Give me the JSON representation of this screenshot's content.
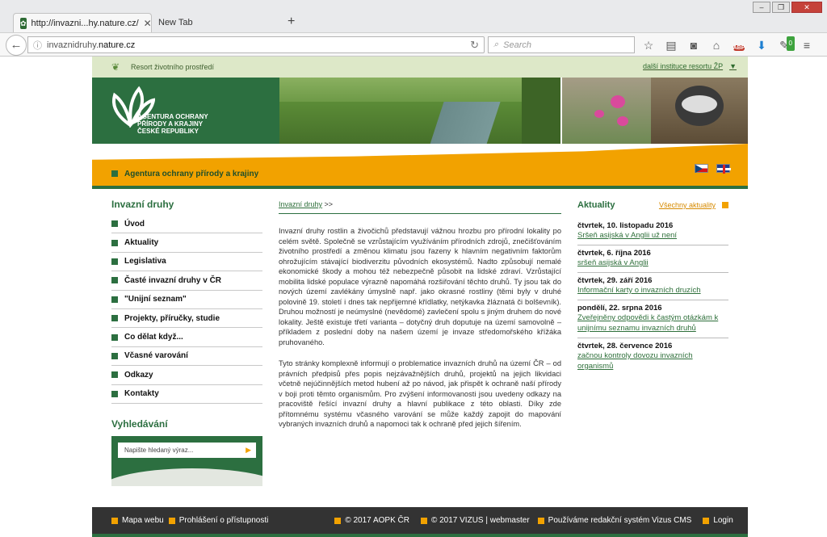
{
  "browser": {
    "tabs": [
      {
        "title": "http://invazni...hy.nature.cz/"
      },
      {
        "title": "New Tab"
      }
    ],
    "new_tab_symbol": "+",
    "url_host": "invaznidruhy.",
    "url_domain": "nature.cz",
    "search_placeholder": "Search",
    "addon_badge": "0",
    "abp_label": "ABP"
  },
  "ministry": {
    "label": "Resort životního prostředí",
    "other_link": "další instituce resortu ŽP"
  },
  "logo": {
    "lines": [
      "AGENTURA OCHRANY",
      "PŘÍRODY A KRAJINY",
      "ČESKÉ REPUBLIKY"
    ]
  },
  "org_bar": {
    "title": "Agentura ochrany přírody a krajiny"
  },
  "sidebar": {
    "heading": "Invazní druhy",
    "items": [
      {
        "label": "Úvod"
      },
      {
        "label": "Aktuality"
      },
      {
        "label": "Legislativa"
      },
      {
        "label": "Časté invazní druhy v ČR"
      },
      {
        "label": "\"Unijní seznam\""
      },
      {
        "label": "Projekty, příručky, studie"
      },
      {
        "label": "Co dělat když..."
      },
      {
        "label": "Včasné varování"
      },
      {
        "label": "Odkazy"
      },
      {
        "label": "Kontakty"
      }
    ],
    "search_heading": "Vyhledávání",
    "search_placeholder": "Napište hledaný výraz..."
  },
  "content": {
    "breadcrumb_link": "Invazní druhy",
    "breadcrumb_sep": ">>",
    "paragraphs": [
      "Invazní druhy rostlin a živočichů představují vážnou hrozbu pro přírodní lokality po celém světě. Společně se vzrůstajícím využíváním přírodních zdrojů, znečišťováním životního prostředí a změnou klimatu jsou řazeny k hlavním negativním faktorům ohrožujícím stávající biodiverzitu původních ekosystémů. Nadto způsobují nemalé ekonomické škody a mohou též nebezpečně působit na lidské zdraví. Vzrůstající mobilita lidské populace výrazně napomáhá rozšiřování těchto druhů. Ty jsou tak do nových území zavlékány úmyslně např. jako okrasné rostliny (těmi byly v druhé polovině 19. století i dnes tak nepřijemné křídlatky, netýkavka žláznatá či bolševník). Druhou možností je neúmyslné (nevědomé) zavlečení spolu s jiným druhem do nové lokality. Ještě existuje třetí varianta – dotyčný druh doputuje na území samovolně – příkladem z poslední doby na našem území je invaze středomořského křížáka pruhovaného.",
      "Tyto stránky komplexně informují o problematice invazních druhů na území ČR – od právních předpisů přes popis nejzávažnějších druhů, projektů na jejich likvidaci včetně nejúčinnějších metod hubení až po návod, jak přispět k ochraně naší přírody v boji proti těmto organismům. Pro zvýšení informovanosti jsou uvedeny odkazy na pracoviště řešící invazní druhy a hlavní publikace z této oblasti. Díky zde přítomnému systému včasného varování se může každý zapojit do mapování vybraných invazních druhů a napomoci tak k ochraně před jejich šířením."
    ]
  },
  "news": {
    "title": "Aktuality",
    "all_link": "Všechny aktuality",
    "items": [
      {
        "date": "čtvrtek, 10. listopadu 2016",
        "text": "Sršeň asijská v Anglii už není"
      },
      {
        "date": "čtvrtek, 6. října 2016",
        "text": "sršeň asijská v Anglii"
      },
      {
        "date": "čtvrtek, 29. září 2016",
        "text": "Informační karty o invazních druzích"
      },
      {
        "date": "pondělí, 22. srpna 2016",
        "text": "Zveřejněny odpovědi k častým otázkám k unijnímu seznamu invazních druhů"
      },
      {
        "date": "čtvrtek, 28. července 2016",
        "text": "začnou kontroly dovozu invazních organismů"
      }
    ]
  },
  "footer": {
    "links": [
      {
        "label": "Mapa webu"
      },
      {
        "label": "Prohlášení o přístupnosti"
      },
      {
        "label": "© 2017 AOPK ČR"
      },
      {
        "label": "© 2017 VIZUS | webmaster"
      },
      {
        "label": "Používáme redakční systém Vizus CMS"
      },
      {
        "label": "Login"
      }
    ]
  },
  "colors": {
    "brand_green": "#2c6f40",
    "accent_orange": "#f2a200",
    "ministry_bg": "#dde8c8",
    "footer_bg": "#333333"
  }
}
